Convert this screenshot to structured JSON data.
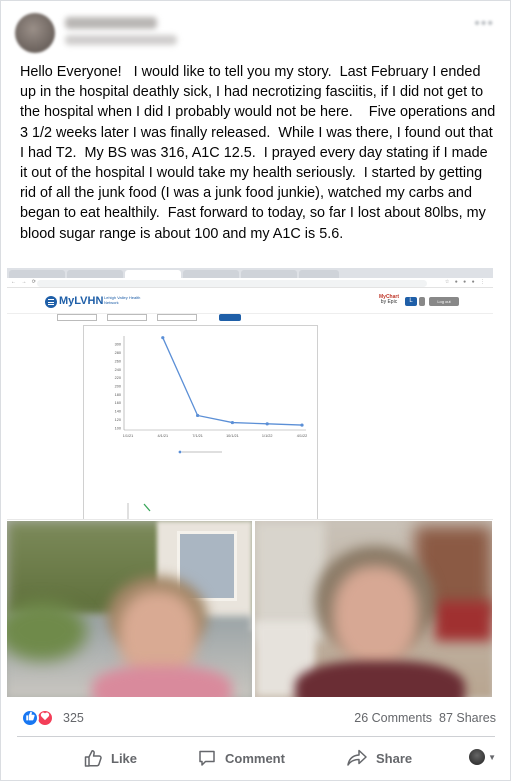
{
  "post": {
    "author": "",
    "text": "Hello Everyone!   I would like to tell you my story.  Last February I ended up in the hospital deathly sick, I had necrotizing fasciitis, if I did not get to the hospital when I did I probably would not be here.    Five operations and 3 1/2 weeks later I was finally released.  While I was there, I found out that I had T2.  My BS was 316, A1C 12.5.  I prayed every day stating if I made it out of the hospital I would take my health seriously.  I started by getting rid of all the junk food (I was a junk food junkie), watched my carbs and began to eat healthily.  Fast forward to today, so far I lost about 80lbs, my blood sugar range is about 100 and my A1C is 5.6."
  },
  "screenshot": {
    "app_name": "MyLVHN",
    "network_name": "Lehigh Valley Health Network",
    "mychart_label": "MyChart",
    "epic_label": "by Epic",
    "user_initial": "L",
    "logout_label": "Log out",
    "brand_color": "#1f5fa8",
    "chart_data": {
      "type": "line",
      "x": [
        "1/1/21",
        "4/1/21",
        "7/1/21",
        "10/1/21",
        "1/1/22",
        "4/1/22"
      ],
      "y_ticks": [
        "300",
        "280",
        "260",
        "240",
        "220",
        "200",
        "180",
        "160",
        "140",
        "120",
        "100"
      ],
      "series": [
        {
          "values": [
            316,
            130,
            113,
            110,
            107
          ]
        }
      ],
      "ylim": [
        100,
        320
      ],
      "grid": false
    }
  },
  "reactions": {
    "count": "325",
    "comments": "26 Comments",
    "shares": "87 Shares",
    "like_color": "#1877f2",
    "love_color": "#f33e58"
  },
  "actions": {
    "like": "Like",
    "comment": "Comment",
    "share": "Share"
  }
}
